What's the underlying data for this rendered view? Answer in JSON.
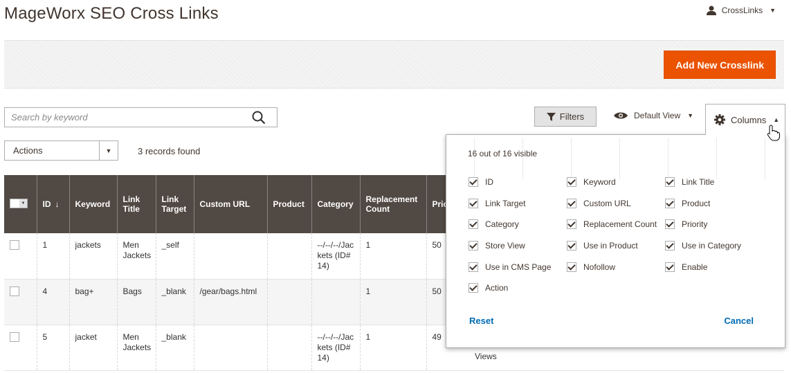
{
  "page": {
    "title": "MageWorx SEO Cross Links"
  },
  "user": {
    "name": "CrossLinks"
  },
  "action_bar": {
    "add_button": "Add New Crosslink"
  },
  "toolbar": {
    "search_placeholder": "Search by keyword",
    "filters_label": "Filters",
    "view_label": "Default View",
    "columns_label": "Columns",
    "actions_label": "Actions",
    "records_found": "3 records found"
  },
  "grid": {
    "headers": [
      "ID",
      "Keyword",
      "Link Title",
      "Link Target",
      "Custom URL",
      "Product",
      "Category",
      "Replacement Count",
      "Prio"
    ],
    "rows": [
      {
        "id": "1",
        "keyword": "jackets",
        "link_title": "Men Jackets",
        "link_target": "_self",
        "custom_url": "",
        "product": "",
        "category": "--/--/--/Jackets (ID#14)",
        "replacement_count": "1",
        "priority": "50"
      },
      {
        "id": "4",
        "keyword": "bag+",
        "link_title": "Bags",
        "link_target": "_blank",
        "custom_url": "/gear/bags.html",
        "product": "",
        "category": "",
        "replacement_count": "1",
        "priority": "50"
      },
      {
        "id": "5",
        "keyword": "jacket",
        "link_title": "Men Jackets",
        "link_target": "_blank",
        "custom_url": "",
        "product": "",
        "category": "--/--/--/Jackets (ID#14)",
        "replacement_count": "1",
        "priority": "49"
      }
    ],
    "trailing_text": "Views"
  },
  "columns_panel": {
    "visible_count": "16 out of 16 visible",
    "options": [
      [
        "ID",
        "Keyword",
        "Link Title"
      ],
      [
        "Link Target",
        "Custom URL",
        "Product"
      ],
      [
        "Category",
        "Replacement Count",
        "Priority"
      ],
      [
        "Store View",
        "Use in Product",
        "Use in Category"
      ],
      [
        "Use in CMS Page",
        "Nofollow",
        "Enable"
      ],
      [
        "Action"
      ]
    ],
    "reset_label": "Reset",
    "cancel_label": "Cancel"
  },
  "colors": {
    "accent": "#eb5202",
    "header_bg": "#514943",
    "link": "#006bb4"
  }
}
